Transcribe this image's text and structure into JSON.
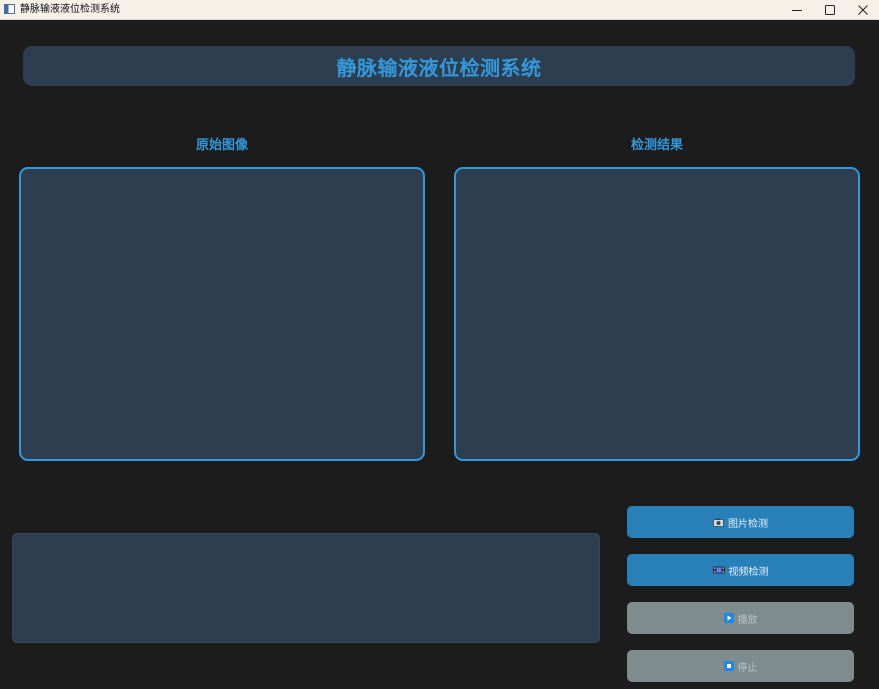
{
  "window": {
    "title": "静脉输液液位检测系统"
  },
  "header": {
    "title": "静脉输液液位检测系统"
  },
  "panels": {
    "original_label": "原始图像",
    "result_label": "检测结果"
  },
  "buttons": {
    "image_detect": "图片检测",
    "video_detect": "视频检测",
    "play": "播放",
    "stop": "停止"
  },
  "icons": {
    "image_detect": "camera-icon",
    "video_detect": "film-icon",
    "play": "play-icon",
    "stop": "stop-icon"
  },
  "colors": {
    "accent": "#3498db",
    "panel_bg": "#2c3e50",
    "button_active": "#2980b9",
    "button_disabled": "#7f8c8d",
    "background": "#1c1c1c"
  }
}
